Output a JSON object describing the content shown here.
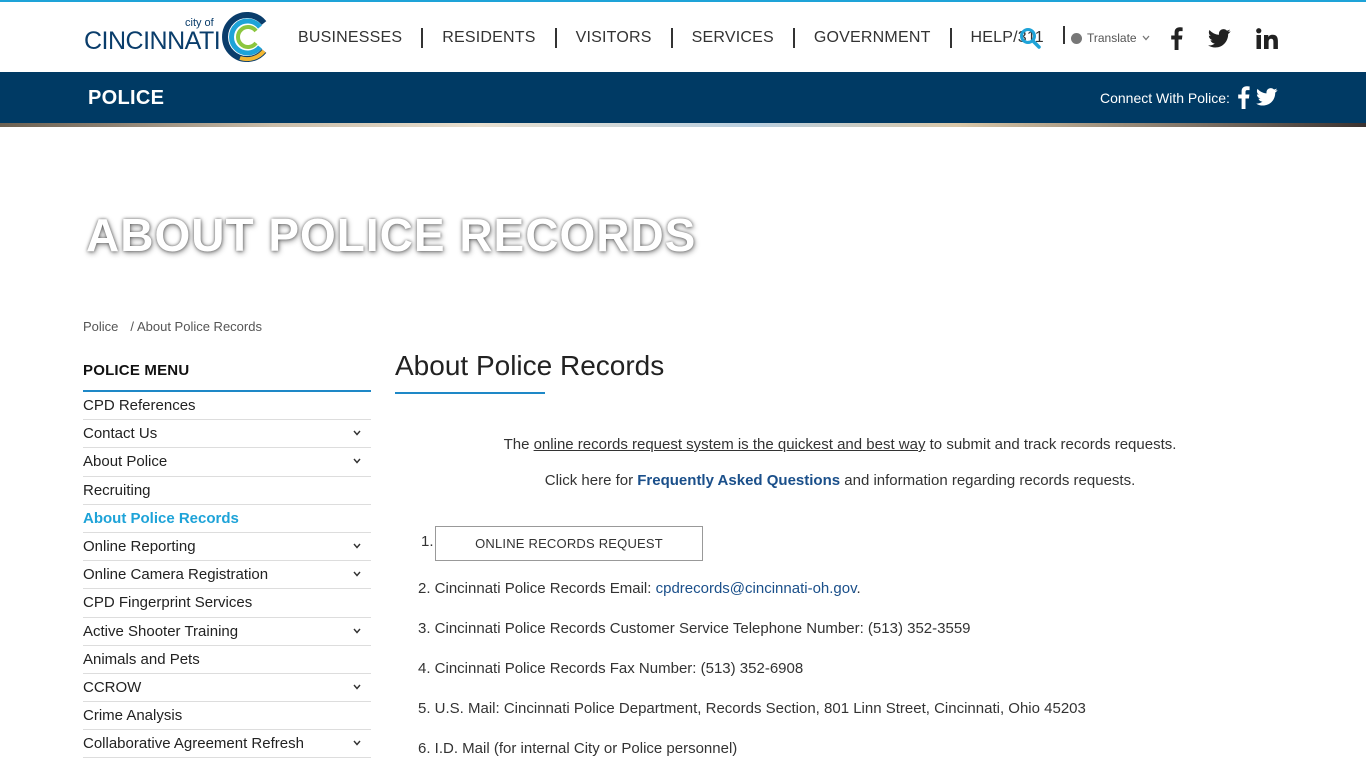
{
  "header": {
    "logo_city_of": "city of",
    "logo_name": "CINCINNATI",
    "nav": [
      "BUSINESSES",
      "RESIDENTS",
      "VISITORS",
      "SERVICES",
      "GOVERNMENT",
      "HELP/311"
    ],
    "translate_label": "Translate",
    "icons": [
      "search-icon",
      "facebook-icon",
      "twitter-icon",
      "linkedin-icon"
    ]
  },
  "police_bar": {
    "department": "POLICE",
    "connect_label": "Connect With Police:"
  },
  "hero": {
    "title": "ABOUT POLICE RECORDS"
  },
  "breadcrumb": {
    "root": "Police",
    "separator": "/",
    "current": "About Police Records"
  },
  "sidebar": {
    "title": "POLICE MENU",
    "items": [
      {
        "label": "CPD References",
        "expandable": false
      },
      {
        "label": "Contact Us",
        "expandable": true
      },
      {
        "label": "About Police",
        "expandable": true
      },
      {
        "label": "Recruiting",
        "expandable": false
      },
      {
        "label": "About Police Records",
        "expandable": false,
        "active": true
      },
      {
        "label": "Online Reporting",
        "expandable": true
      },
      {
        "label": "Online Camera Registration",
        "expandable": true
      },
      {
        "label": "CPD Fingerprint Services",
        "expandable": false
      },
      {
        "label": "Active Shooter Training",
        "expandable": true
      },
      {
        "label": "Animals and Pets",
        "expandable": false
      },
      {
        "label": "CCROW",
        "expandable": true
      },
      {
        "label": "Crime Analysis",
        "expandable": false
      },
      {
        "label": "Collaborative Agreement Refresh",
        "expandable": true
      }
    ]
  },
  "content": {
    "title": "About Police Records",
    "intro_pre": "The ",
    "intro_link": "online records request system is the quickest and best way",
    "intro_post": " to submit and track records requests.",
    "faq_pre": "Click here for ",
    "faq_link": "Frequently Asked Questions",
    "faq_post": " and information regarding records requests.",
    "item1_num": "1.",
    "records_button": "ONLINE RECORDS REQUEST",
    "item2_pre": "2. Cincinnati Police Records Email: ",
    "item2_email": "cpdrecords@cincinnati-oh.gov",
    "item2_post": ".",
    "item3": "3. Cincinnati Police Records Customer Service Telephone Number: (513) 352-3559",
    "item4": "4. Cincinnati Police Records Fax Number: (513) 352-6908",
    "item5": "5. U.S. Mail: Cincinnati Police Department, Records Section, 801 Linn Street, Cincinnati, Ohio 45203",
    "item6": "6. I.D. Mail (for internal City or Police personnel)"
  },
  "colors": {
    "brand_navy": "#003a64",
    "accent_blue": "#1ea3d8",
    "link_blue": "#1a4f8a"
  }
}
